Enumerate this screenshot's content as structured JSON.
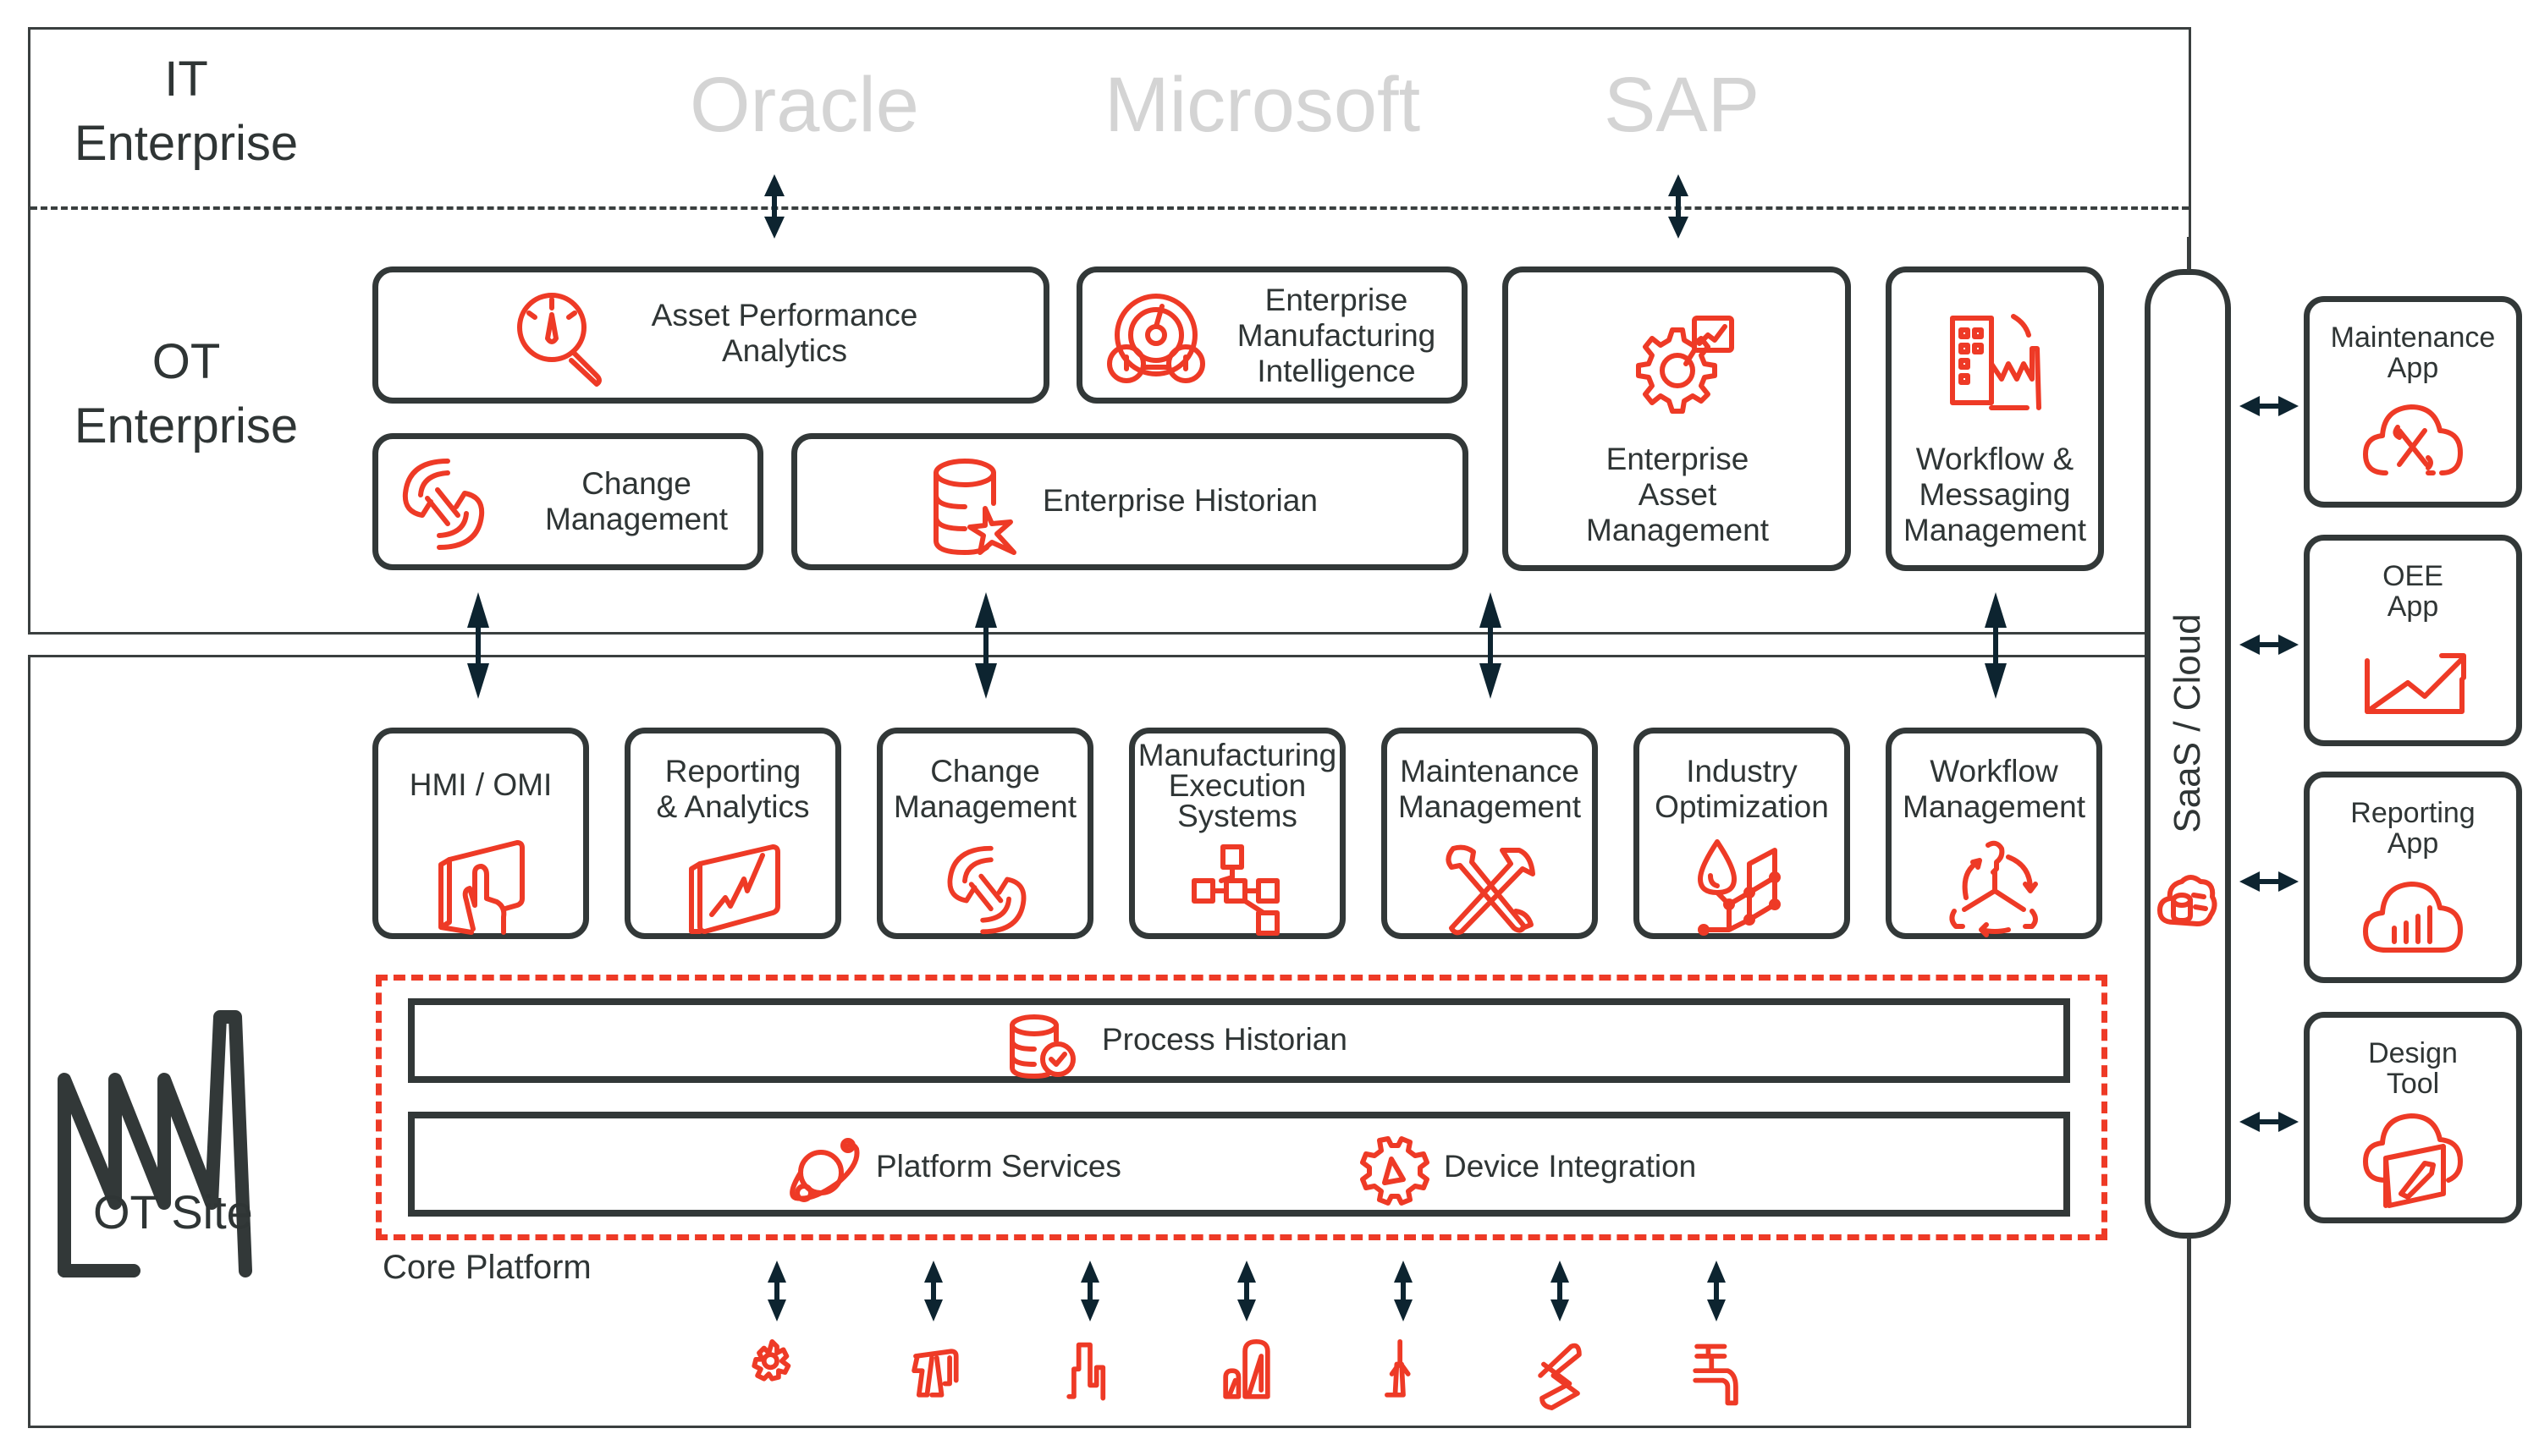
{
  "zones": {
    "it_enterprise": "IT\nEnterprise",
    "it_enterprise_line1": "IT",
    "it_enterprise_line2": "Enterprise",
    "ot_enterprise_line1": "OT",
    "ot_enterprise_line2": "Enterprise",
    "ot_site": "OT Site",
    "core_platform": "Core Platform"
  },
  "vendors": [
    "Oracle",
    "Microsoft",
    "SAP"
  ],
  "ot_enterprise_modules": [
    {
      "id": "asset-performance-analytics",
      "lines": [
        "Asset Performance",
        "Analytics"
      ],
      "icon": "gauge-magnifier-icon"
    },
    {
      "id": "enterprise-manufacturing-intelligence",
      "lines": [
        "Enterprise",
        "Manufacturing",
        "Intelligence"
      ],
      "icon": "dashboard-gauges-icon"
    },
    {
      "id": "enterprise-asset-management",
      "lines": [
        "Enterprise",
        "Asset",
        "Management"
      ],
      "icon": "gear-chart-icon"
    },
    {
      "id": "workflow-messaging-management",
      "lines": [
        "Workflow &",
        "Messaging",
        "Management"
      ],
      "icon": "building-factory-icon"
    },
    {
      "id": "change-management-enterprise",
      "lines": [
        "Change",
        "Management"
      ],
      "icon": "cycle-arrows-icon"
    },
    {
      "id": "enterprise-historian",
      "lines": [
        "Enterprise Historian"
      ],
      "icon": "database-star-icon"
    }
  ],
  "ot_site_modules": [
    {
      "id": "hmi-omi",
      "lines": [
        "HMI / OMI"
      ],
      "icon": "touch-screen-icon"
    },
    {
      "id": "reporting-analytics",
      "lines": [
        "Reporting",
        "& Analytics"
      ],
      "icon": "chart-screen-icon"
    },
    {
      "id": "change-management-site",
      "lines": [
        "Change",
        "Management"
      ],
      "icon": "cycle-arrows-icon"
    },
    {
      "id": "manufacturing-execution-systems",
      "lines": [
        "Manufacturing",
        "Execution",
        "Systems"
      ],
      "icon": "flow-blocks-icon"
    },
    {
      "id": "maintenance-management",
      "lines": [
        "Maintenance",
        "Management"
      ],
      "icon": "wrench-hammer-icon"
    },
    {
      "id": "industry-optimization",
      "lines": [
        "Industry",
        "Optimization"
      ],
      "icon": "drop-network-icon"
    },
    {
      "id": "workflow-management",
      "lines": [
        "Workflow",
        "Management"
      ],
      "icon": "people-cycle-icon"
    }
  ],
  "core_platform": {
    "process_historian": "Process Historian",
    "platform_services": "Platform Services",
    "device_integration": "Device Integration"
  },
  "field_devices": [
    "gear-icon",
    "oil-pump-icon",
    "factory-skyline-icon",
    "silo-tank-icon",
    "wind-turbine-icon",
    "pipeline-icon",
    "water-tap-icon"
  ],
  "saas": {
    "label": "SaaS / Cloud",
    "icon": "cloud-database-icon"
  },
  "cloud_apps": [
    {
      "id": "maintenance-app",
      "lines": [
        "Maintenance",
        "App"
      ],
      "icon": "cloud-tools-icon"
    },
    {
      "id": "oee-app",
      "lines": [
        "OEE",
        "App"
      ],
      "icon": "trend-chart-icon"
    },
    {
      "id": "reporting-app",
      "lines": [
        "Reporting",
        "App"
      ],
      "icon": "cloud-bars-icon"
    },
    {
      "id": "design-tool",
      "lines": [
        "Design",
        "Tool"
      ],
      "icon": "cloud-pen-icon"
    }
  ],
  "colors": {
    "accent": "#ee3a26",
    "border": "#323838",
    "arrow": "#0d2430",
    "vendor_text": "#d4d4d4",
    "text": "#2f3535"
  }
}
